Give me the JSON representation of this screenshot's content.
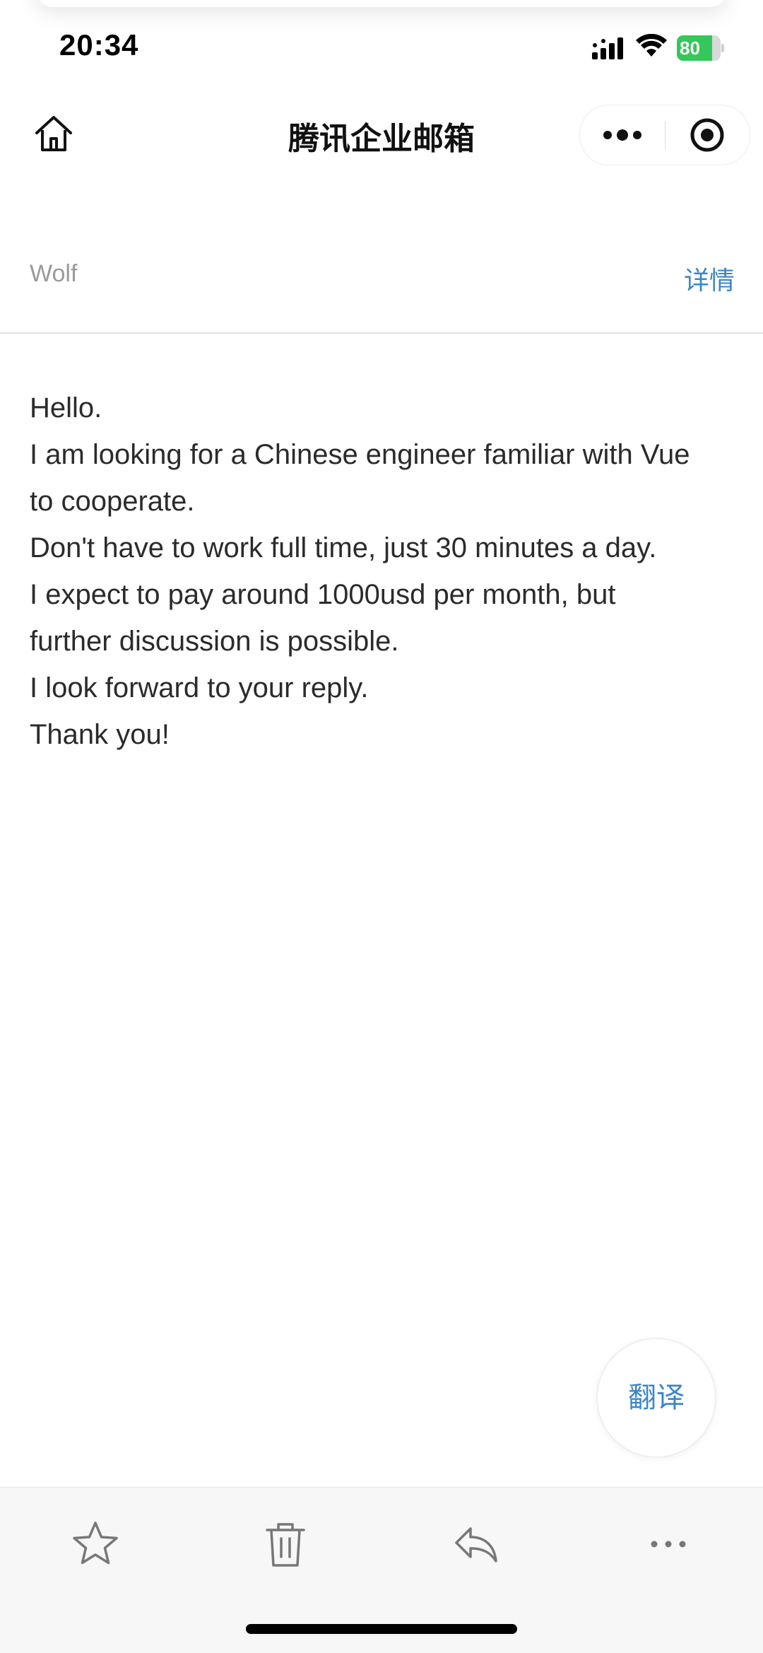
{
  "status_bar": {
    "time": "20:34",
    "battery_percent": 80,
    "battery_label": "80",
    "icons": [
      "signal-icon",
      "wifi-icon",
      "battery-charging-icon"
    ],
    "battery_color": "#35c759"
  },
  "nav": {
    "title": "腾讯企业邮箱",
    "icons": [
      "home-icon",
      "more-icon",
      "close-target-icon"
    ]
  },
  "sender": {
    "name": "Wolf",
    "details_label": "详情"
  },
  "mail": {
    "lines": [
      "Hello.",
      "I am looking for a Chinese engineer familiar with Vue",
      "to cooperate.",
      "Don't have to work full time, just 30 minutes a day.",
      "I expect to pay around 1000usd per month, but",
      "further discussion is possible.",
      "I look forward to your reply.",
      "Thank you!"
    ]
  },
  "translate": {
    "label": "翻译"
  },
  "toolbar": {
    "icons": [
      "star-icon",
      "trash-icon",
      "reply-icon",
      "more-horizontal-icon"
    ]
  },
  "colors": {
    "accent": "#3a86c8",
    "sender_gray": "#9a9a9a",
    "toolbar_bg": "#f7f7f7"
  }
}
